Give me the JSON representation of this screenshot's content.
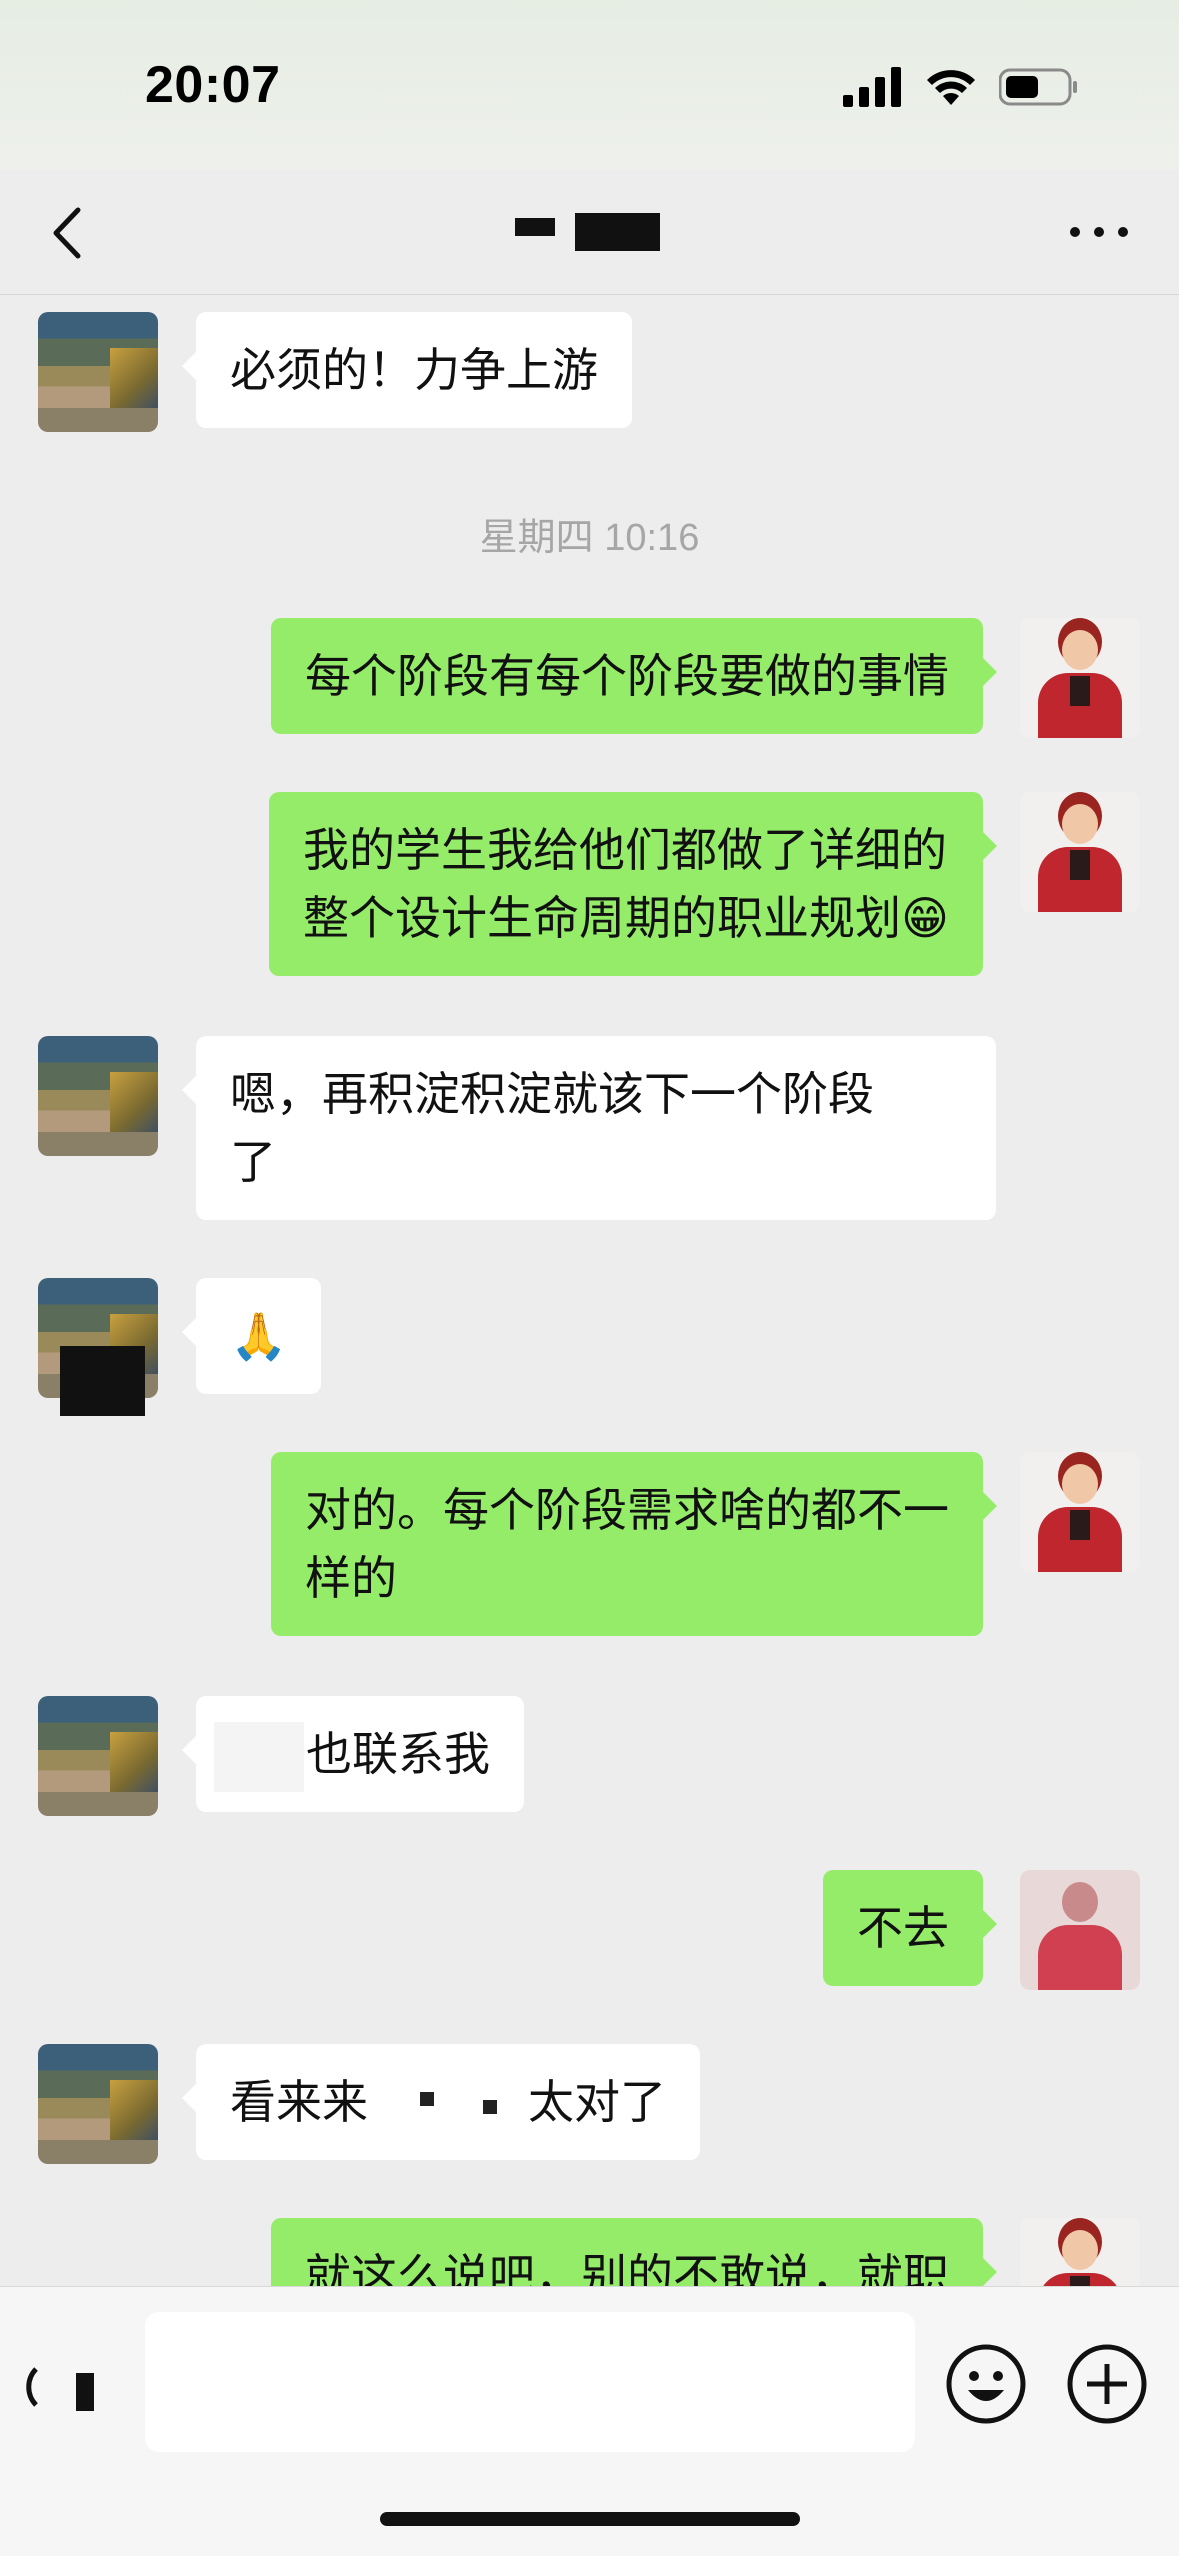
{
  "status_bar": {
    "time": "20:07"
  },
  "nav": {
    "title": ""
  },
  "chat": {
    "timestamp": "星期四 10:16",
    "messages": [
      {
        "side": "left",
        "text": "必须的！力争上游"
      },
      {
        "side": "right",
        "text": "每个阶段有每个阶段要做的事情"
      },
      {
        "side": "right",
        "line1": "我的学生我给他们都做了详细的",
        "line2": "整个设计生命周期的职业规划😁"
      },
      {
        "side": "left",
        "line1": "嗯，再积淀积淀就该下一个阶段",
        "line2": "了"
      },
      {
        "side": "left",
        "text": "🙏"
      },
      {
        "side": "right",
        "line1": "对的。每个阶段需求啥的都不一",
        "line2": "样的"
      },
      {
        "side": "left",
        "text": "也联系我"
      },
      {
        "side": "right",
        "text": "不去"
      },
      {
        "side": "left",
        "part1": "看来来",
        "part2": "太对了"
      },
      {
        "side": "right",
        "text": "就这么说吧，别的不敢说，就职"
      }
    ]
  },
  "input_bar": {
    "placeholder": ""
  },
  "colors": {
    "background": "#ededed",
    "bubble_self": "#95ec69",
    "bubble_other": "#ffffff",
    "timestamp": "#a6a6a6"
  },
  "icons": [
    "signal-icon",
    "wifi-icon",
    "battery-icon",
    "back-icon",
    "more-icon",
    "voice-icon",
    "emoji-icon",
    "plus-icon"
  ]
}
